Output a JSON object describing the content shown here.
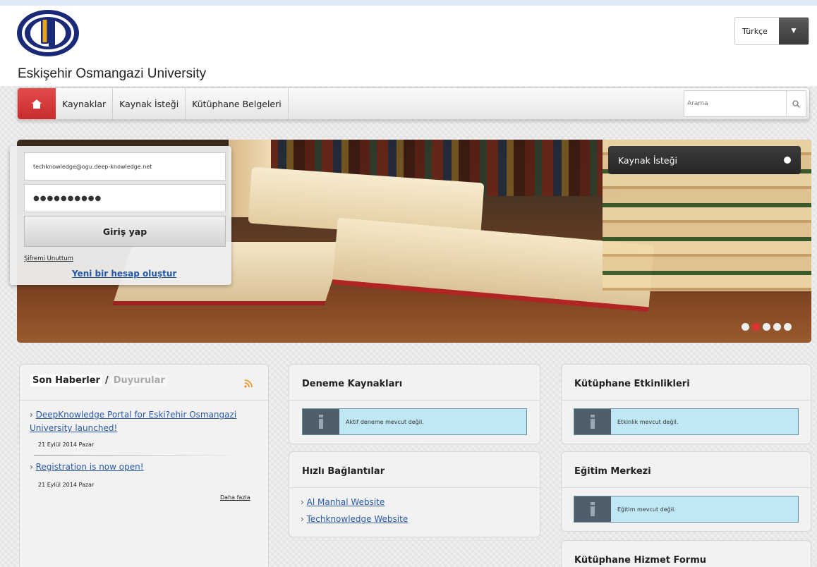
{
  "brand": {
    "university_name": "Eskişehir Osmangazi University"
  },
  "language": {
    "selected": "Türkçe"
  },
  "nav": {
    "items": [
      "Kaynaklar",
      "Kaynak İsteği",
      "Kütüphane Belgeleri"
    ],
    "search_placeholder": "Arama"
  },
  "login": {
    "email_value": "techknowledge@ogu.deep-knowledge.net",
    "password_value": "●●●●●●●●●●",
    "submit_label": "Giriş yap",
    "forgot_label": "Şifremi Unuttum",
    "new_account_label": "Yeni bir hesap oluştur"
  },
  "banner": {
    "request_label": "Kaynak İsteği",
    "active_slide": 2,
    "slide_count": 5
  },
  "news": {
    "tab_news": "Son Haberler",
    "separator": "/",
    "tab_announcements": "Duyurular",
    "items": [
      {
        "title": "DeepKnowledge Portal for Eski?ehir Osmangazi University launched!",
        "date": "21 Eylül 2014 Pazar"
      },
      {
        "title": "Registration is now open!",
        "date": "21 Eylül 2014 Pazar"
      }
    ],
    "more_label": "Daha fazla"
  },
  "trial": {
    "title": "Deneme Kaynakları",
    "message": "Aktif deneme mevcut değil."
  },
  "quick_links": {
    "title": "Hızlı Bağlantılar",
    "items": [
      "Al Manhal Website",
      "Techknowledge Website"
    ]
  },
  "events": {
    "title": "Kütüphane Etkinlikleri",
    "message": "Etkinlik mevcut değil."
  },
  "education": {
    "title": "Eğitim Merkezi",
    "message": "Eğitim mevcut değil."
  },
  "service_form": {
    "title": "Kütüphane Hizmet Formu"
  },
  "colors": {
    "accent_red": "#c82c2c",
    "link_blue": "#2a5aa8",
    "alert_bg": "#bfe8f4",
    "logo_navy": "#1a2a78",
    "logo_gold": "#e8a51c"
  }
}
